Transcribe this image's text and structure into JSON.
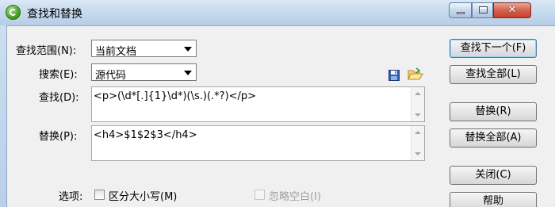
{
  "window": {
    "title": "查找和替换"
  },
  "scope": {
    "label": "查找范围(N):",
    "value": "当前文档"
  },
  "search": {
    "label": "搜索(E):",
    "value": "源代码"
  },
  "find": {
    "label": "查找(D):",
    "value": "<p>(\\d*[.]{1}\\d*)(\\s.)(.*?)</p>"
  },
  "replace": {
    "label": "替换(P):",
    "value": "<h4>$1$2$3</h4>"
  },
  "buttons": {
    "find_next": "查找下一个(F)",
    "find_all": "查找全部(L)",
    "replace": "替换(R)",
    "replace_all": "替换全部(A)",
    "close": "关闭(C)",
    "help": "帮助"
  },
  "options": {
    "label": "选项:",
    "match_case": "区分大小写(M)",
    "ignore_whitespace": "忽略空白(I)"
  },
  "icons": {
    "save": "save-icon",
    "open": "open-folder-icon"
  }
}
